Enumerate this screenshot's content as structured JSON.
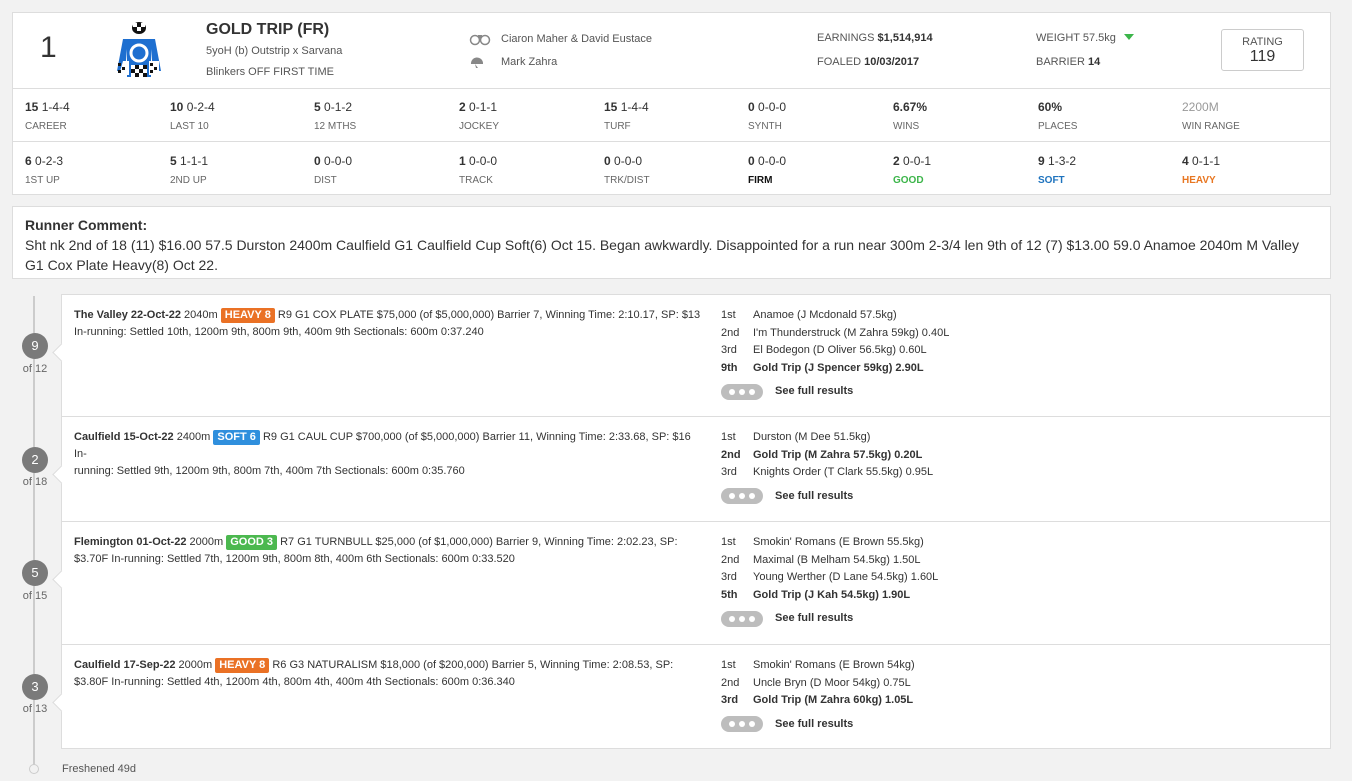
{
  "header": {
    "number": "1",
    "name": "GOLD TRIP (FR)",
    "breeding": "5yoH (b) Outstrip x Sarvana",
    "gear": "Blinkers OFF FIRST TIME",
    "trainer": "Ciaron Maher & David Eustace",
    "jockey": "Mark Zahra",
    "earnings_label": "EARNINGS",
    "earnings_value": "$1,514,914",
    "foaled_label": "FOALED",
    "foaled_value": "10/03/2017",
    "weight_label": "WEIGHT",
    "weight_value": "57.5kg",
    "barrier_label": "BARRIER",
    "barrier_value": "14",
    "rating_label": "RATING",
    "rating_value": "119"
  },
  "stats_row1": [
    {
      "bold": "15",
      "rest": " 1-4-4",
      "label": "CAREER"
    },
    {
      "bold": "10",
      "rest": " 0-2-4",
      "label": "LAST 10"
    },
    {
      "bold": "5",
      "rest": " 0-1-2",
      "label": "12 MTHS"
    },
    {
      "bold": "2",
      "rest": " 0-1-1",
      "label": "JOCKEY"
    },
    {
      "bold": "15",
      "rest": " 1-4-4",
      "label": "TURF"
    },
    {
      "bold": "0",
      "rest": " 0-0-0",
      "label": "SYNTH"
    },
    {
      "bold": "6.67%",
      "rest": "",
      "label": "WINS"
    },
    {
      "bold": "60%",
      "rest": "",
      "label": "PLACES"
    },
    {
      "bold": "",
      "rest": "2200M",
      "label": "WIN RANGE"
    }
  ],
  "stats_row2": [
    {
      "bold": "6",
      "rest": " 0-2-3",
      "label": "1ST UP"
    },
    {
      "bold": "5",
      "rest": " 1-1-1",
      "label": "2ND UP"
    },
    {
      "bold": "0",
      "rest": " 0-0-0",
      "label": "DIST"
    },
    {
      "bold": "1",
      "rest": " 0-0-0",
      "label": "TRACK"
    },
    {
      "bold": "0",
      "rest": " 0-0-0",
      "label": "TRK/DIST"
    },
    {
      "bold": "0",
      "rest": " 0-0-0",
      "label": "FIRM"
    },
    {
      "bold": "2",
      "rest": " 0-0-1",
      "label": "GOOD"
    },
    {
      "bold": "9",
      "rest": " 1-3-2",
      "label": "SOFT"
    },
    {
      "bold": "4",
      "rest": " 0-1-1",
      "label": "HEAVY"
    }
  ],
  "comment": {
    "title": "Runner Comment:",
    "text": "Sht nk 2nd of 18 (11) $16.00 57.5 Durston 2400m Caulfield G1 Caulfield Cup Soft(6) Oct 15. Began awkwardly. Disappointed for a run near 300m 2-3/4 len 9th of 12 (7) $13.00 59.0 Anamoe 2040m M Valley G1 Cox Plate Heavy(8) Oct 22."
  },
  "races": [
    {
      "pos": "9",
      "of": "of 12",
      "venue_date": "The Valley 22-Oct-22",
      "dist": " 2040m ",
      "track": "HEAVY 8",
      "line1_rest": " R9 G1 COX PLATE $75,000 (of $5,000,000) Barrier 7, Winning Time: 2:10.17, SP: $13",
      "line2": "In-running: Settled 10th, 1200m 9th, 800m 9th, 400m 9th Sectionals: 600m 0:37.240",
      "results": [
        {
          "p": "1st",
          "t": "Anamoe (J Mcdonald 57.5kg)"
        },
        {
          "p": "2nd",
          "t": "I'm Thunderstruck (M Zahra 59kg) 0.40L"
        },
        {
          "p": "3rd",
          "t": "El Bodegon (D Oliver 56.5kg) 0.60L"
        },
        {
          "p": "9th",
          "t": "Gold Trip (J Spencer 59kg) 2.90L"
        }
      ],
      "see_full": "See full results"
    },
    {
      "pos": "2",
      "of": "of 18",
      "venue_date": "Caulfield 15-Oct-22",
      "dist": " 2400m ",
      "track": "SOFT 6",
      "line1_rest": " R9 G1 CAUL CUP $700,000 (of $5,000,000) Barrier 11, Winning Time: 2:33.68, SP: $16 In-",
      "line2": "running: Settled 9th, 1200m 9th, 800m 7th, 400m 7th Sectionals: 600m 0:35.760",
      "results": [
        {
          "p": "1st",
          "t": "Durston (M Dee 51.5kg)"
        },
        {
          "p": "2nd",
          "t": "Gold Trip (M Zahra 57.5kg) 0.20L"
        },
        {
          "p": "3rd",
          "t": "Knights Order (T Clark 55.5kg) 0.95L"
        }
      ],
      "see_full": "See full results"
    },
    {
      "pos": "5",
      "of": "of 15",
      "venue_date": "Flemington 01-Oct-22",
      "dist": " 2000m ",
      "track": "GOOD 3",
      "line1_rest": " R7 G1 TURNBULL $25,000 (of $1,000,000) Barrier 9, Winning Time: 2:02.23, SP:",
      "line2": "$3.70F In-running: Settled 7th, 1200m 9th, 800m 8th, 400m 6th Sectionals: 600m 0:33.520",
      "results": [
        {
          "p": "1st",
          "t": "Smokin' Romans (E Brown 55.5kg)"
        },
        {
          "p": "2nd",
          "t": "Maximal (B Melham 54.5kg) 1.50L"
        },
        {
          "p": "3rd",
          "t": "Young Werther (D Lane 54.5kg) 1.60L"
        },
        {
          "p": "5th",
          "t": "Gold Trip (J Kah 54.5kg) 1.90L"
        }
      ],
      "see_full": "See full results"
    },
    {
      "pos": "3",
      "of": "of 13",
      "venue_date": "Caulfield 17-Sep-22",
      "dist": " 2000m ",
      "track": "HEAVY 8",
      "line1_rest": " R6 G3 NATURALISM $18,000 (of $200,000) Barrier 5, Winning Time: 2:08.53, SP:",
      "line2": "$3.80F In-running: Settled 4th, 1200m 4th, 800m 4th, 400m 4th Sectionals: 600m 0:36.340",
      "results": [
        {
          "p": "1st",
          "t": "Smokin' Romans (E Brown 54kg)"
        },
        {
          "p": "2nd",
          "t": "Uncle Bryn (D Moor 54kg) 0.75L"
        },
        {
          "p": "3rd",
          "t": "Gold Trip (M Zahra 60kg) 1.05L"
        }
      ],
      "see_full": "See full results"
    }
  ],
  "freshened": "Freshened 49d",
  "colors": {
    "heavy": "#ea7125",
    "soft": "#2f8fdd",
    "good": "#4cb84f",
    "accent_green": "#3cb54a"
  }
}
